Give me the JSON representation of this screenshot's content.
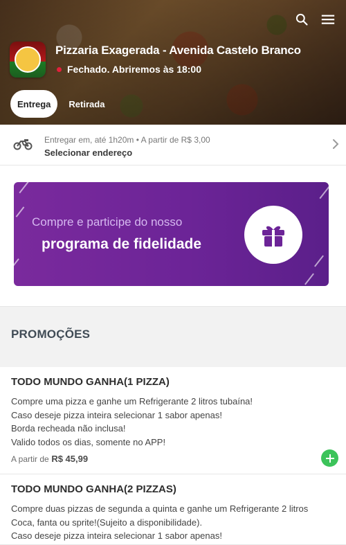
{
  "header": {
    "store_name": "Pizzaria Exagerada - Avenida Castelo Branco",
    "status_text": "Fechado. Abriremos às 18:00",
    "status_color": "#e2203c",
    "logo_text": "Pizzaria Exagerada",
    "icons": [
      "search-icon",
      "menu-icon"
    ]
  },
  "tabs": [
    {
      "label": "Entrega",
      "active": true
    },
    {
      "label": "Retirada",
      "active": false
    }
  ],
  "delivery": {
    "line1": "Entregar em, até 1h20m  •  A partir de R$ 3,00",
    "address_label": "Selecionar endereço",
    "icon": "motorcycle-icon"
  },
  "banner": {
    "line1": "Compre e participe do nosso",
    "line2": "programa de fidelidade",
    "icon": "gift-icon",
    "color": "#6c2497"
  },
  "section": {
    "title": "PROMOÇÕES"
  },
  "products": [
    {
      "title": "TODO MUNDO GANHA(1 PIZZA)",
      "description": [
        "Compre uma pizza e ganhe um Refrigerante 2 litros tubaína!",
        "Caso deseje pizza inteira selecionar 1 sabor apenas!",
        "Borda recheada não inclusa!",
        "Valido todos os dias, somente no APP!"
      ],
      "price_prefix": "A partir de",
      "price": "R$ 45,99"
    },
    {
      "title": "TODO MUNDO GANHA(2 PIZZAS)",
      "description": [
        "Compre duas pizzas de segunda a quinta e ganhe um Refrigerante 2 litros",
        "Coca, fanta ou sprite!(Sujeito a disponibilidade).",
        "Caso deseje pizza inteira selecionar 1 sabor apenas!"
      ]
    }
  ],
  "colors": {
    "accent_green": "#3cc35a",
    "text_dark": "#2d2d2d"
  }
}
